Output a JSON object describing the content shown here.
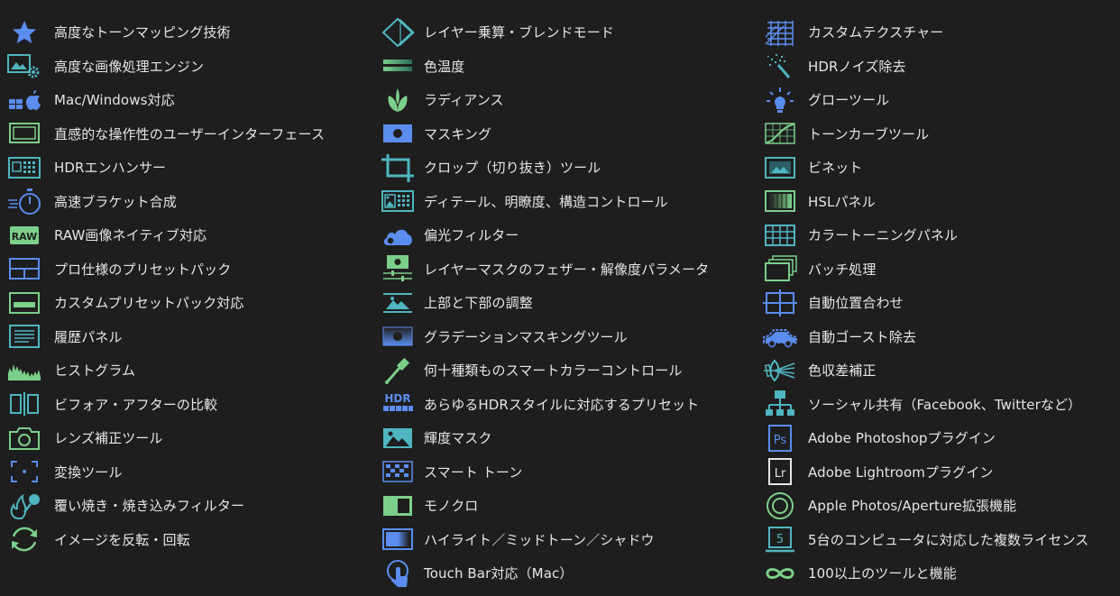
{
  "theme": {
    "background": "#1e1e1e",
    "text": "#e6e6e6",
    "icon_blue": "#5b8def",
    "icon_teal": "#4fb5c0",
    "icon_green": "#7ccf8a"
  },
  "features": {
    "column1": [
      {
        "label": "高度なトーンマッピング技術",
        "icon": "star-icon"
      },
      {
        "label": "高度な画像処理エンジン",
        "icon": "image-gear-icon"
      },
      {
        "label": "Mac/Windows対応",
        "icon": "windows-apple-icon"
      },
      {
        "label": "直感的な操作性のユーザーインターフェース",
        "icon": "monitor-icon"
      },
      {
        "label": "HDRエンハンサー",
        "icon": "hdr-enhancer-icon"
      },
      {
        "label": "高速ブラケット合成",
        "icon": "stopwatch-icon"
      },
      {
        "label": "RAW画像ネイティブ対応",
        "icon": "raw-icon"
      },
      {
        "label": "プロ仕様のプリセットパック",
        "icon": "preset-pack-icon"
      },
      {
        "label": "カスタムプリセットパック対応",
        "icon": "custom-preset-icon"
      },
      {
        "label": "履歴パネル",
        "icon": "history-icon"
      },
      {
        "label": "ヒストグラム",
        "icon": "histogram-icon"
      },
      {
        "label": "ビフォア・アフターの比較",
        "icon": "before-after-icon"
      },
      {
        "label": "レンズ補正ツール",
        "icon": "camera-icon"
      },
      {
        "label": "変換ツール",
        "icon": "transform-icon"
      },
      {
        "label": "覆い焼き・焼き込みフィルター",
        "icon": "dodge-burn-icon"
      },
      {
        "label": "イメージを反転・回転",
        "icon": "rotate-icon"
      }
    ],
    "column2": [
      {
        "label": "レイヤー乗算・ブレンドモード",
        "icon": "layers-icon"
      },
      {
        "label": "色温度",
        "icon": "temperature-icon"
      },
      {
        "label": "ラディアンス",
        "icon": "leaf-icon"
      },
      {
        "label": "マスキング",
        "icon": "mask-icon"
      },
      {
        "label": "クロップ（切り抜き）ツール",
        "icon": "crop-icon"
      },
      {
        "label": "ディテール、明瞭度、構造コントロール",
        "icon": "detail-icon"
      },
      {
        "label": "偏光フィルター",
        "icon": "cloud-icon"
      },
      {
        "label": "レイヤーマスクのフェザー・解像度パラメータ",
        "icon": "feather-icon"
      },
      {
        "label": "上部と下部の調整",
        "icon": "top-bottom-icon"
      },
      {
        "label": "グラデーションマスキングツール",
        "icon": "gradient-mask-icon"
      },
      {
        "label": "何十種類ものスマートカラーコントロール",
        "icon": "eyedropper-icon"
      },
      {
        "label": "あらゆるHDRスタイルに対応するプリセット",
        "icon": "hdr-preset-icon"
      },
      {
        "label": "輝度マスク",
        "icon": "luminance-icon"
      },
      {
        "label": "スマート トーン",
        "icon": "smart-tone-icon"
      },
      {
        "label": "モノクロ",
        "icon": "mono-icon"
      },
      {
        "label": "ハイライト／ミッドトーン／シャドウ",
        "icon": "highlights-icon"
      },
      {
        "label": "Touch Bar対応（Mac）",
        "icon": "touch-icon"
      }
    ],
    "column3": [
      {
        "label": "カスタムテクスチャー",
        "icon": "texture-icon"
      },
      {
        "label": "HDRノイズ除去",
        "icon": "magic-wand-icon"
      },
      {
        "label": "グローツール",
        "icon": "bulb-icon"
      },
      {
        "label": "トーンカーブツール",
        "icon": "curve-icon"
      },
      {
        "label": "ビネット",
        "icon": "vignette-icon"
      },
      {
        "label": "HSLパネル",
        "icon": "hsl-icon"
      },
      {
        "label": "カラートーニングパネル",
        "icon": "color-toning-icon"
      },
      {
        "label": "バッチ処理",
        "icon": "batch-icon"
      },
      {
        "label": "自動位置合わせ",
        "icon": "align-icon"
      },
      {
        "label": "自動ゴースト除去",
        "icon": "car-icon"
      },
      {
        "label": "色収差補正",
        "icon": "lens-icon"
      },
      {
        "label": "ソーシャル共有（Facebook、Twitterなど）",
        "icon": "share-icon"
      },
      {
        "label": "Adobe Photoshopプラグイン",
        "icon": "photoshop-icon",
        "badge": "Ps"
      },
      {
        "label": "Adobe Lightroomプラグイン",
        "icon": "lightroom-icon",
        "badge": "Lr"
      },
      {
        "label": "Apple Photos/Aperture拡張機能",
        "icon": "photos-icon"
      },
      {
        "label": "5台のコンピュータに対応した複数ライセンス",
        "icon": "license-icon",
        "badge": "5"
      },
      {
        "label": "100以上のツールと機能",
        "icon": "infinity-icon"
      }
    ]
  }
}
